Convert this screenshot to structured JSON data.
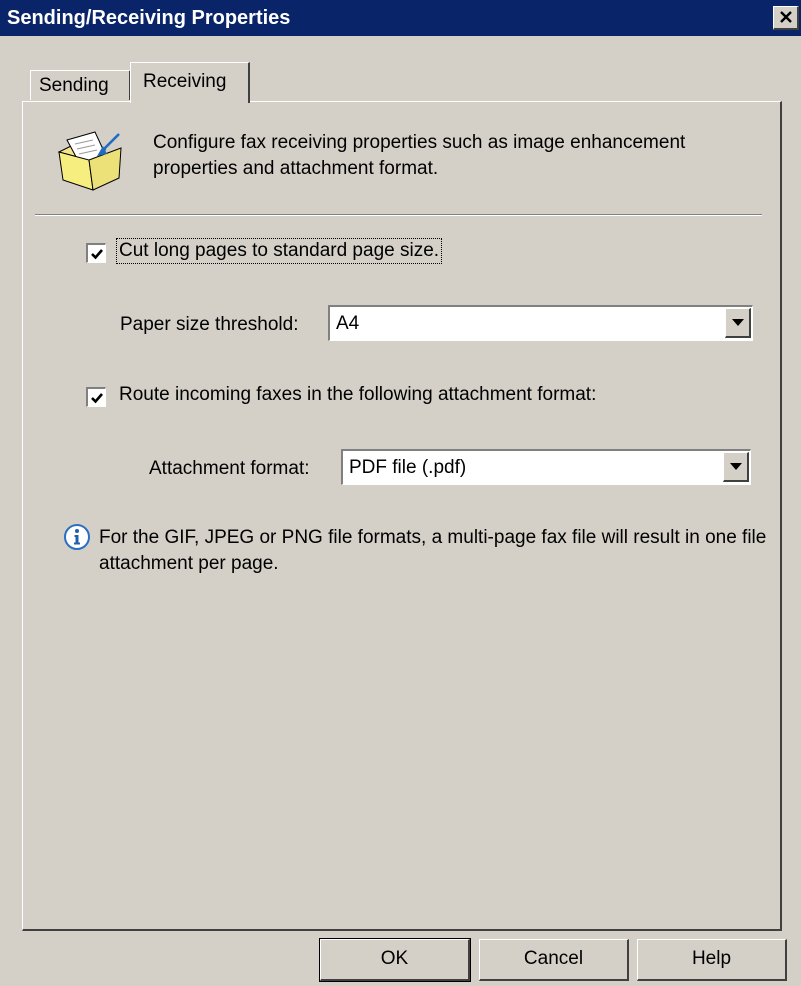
{
  "window": {
    "title": "Sending/Receiving Properties"
  },
  "tabs": [
    {
      "label": "Sending",
      "active": false
    },
    {
      "label": "Receiving",
      "active": true
    }
  ],
  "header": {
    "icon": "fax-receive-folder-icon",
    "description": "Configure fax receiving properties such as image enhancement properties and attachment format."
  },
  "options": {
    "cut_long_pages": {
      "label": "Cut long pages to standard page size.",
      "checked": true
    },
    "paper_size": {
      "label": "Paper size threshold:",
      "value": "A4"
    },
    "route_attachment": {
      "label": "Route incoming faxes in the following attachment format:",
      "checked": true
    },
    "attachment_format": {
      "label": "Attachment format:",
      "value": "PDF file (.pdf)"
    }
  },
  "info": {
    "icon": "info-icon",
    "text": "For the GIF, JPEG or PNG file formats, a multi-page fax file will result in one file attachment per page."
  },
  "buttons": {
    "ok": "OK",
    "cancel": "Cancel",
    "help": "Help"
  },
  "colors": {
    "titlebar": "#0a246a",
    "face": "#d4d0c8",
    "info_icon": "#2a6fc4"
  }
}
